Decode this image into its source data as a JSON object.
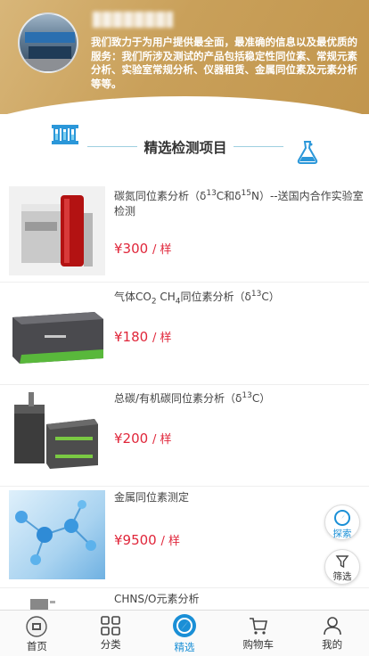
{
  "header": {
    "intro": "我们致力于为用户提供最全面，最准确的信息以及最优质的服务：我们所涉及测试的产品包括稳定性同位素、常规元素分析、实验室常规分析、仪器租赁、金属同位素及元素分析等等。"
  },
  "section": {
    "title": "精选检测项目"
  },
  "items": [
    {
      "title_pre": "碳氮同位素分析（δ",
      "sup1": "13",
      "title_mid": "C和δ",
      "sup2": "15",
      "title_post": "N）--送国内合作实验室检测",
      "price": "¥300",
      "unit": "/ 样"
    },
    {
      "title_pre": "气体CO",
      "sub1": "2",
      "title_mid": " CH",
      "sub2": "4",
      "title_mid2": "同位素分析（δ",
      "sup1": "13",
      "title_post": "C）",
      "price": "¥180",
      "unit": "/ 样"
    },
    {
      "title_pre": "总碳/有机碳同位素分析（δ",
      "sup1": "13",
      "title_post": "C）",
      "price": "¥200",
      "unit": "/ 样"
    },
    {
      "title": "金属同位素测定",
      "price": "¥9500",
      "unit": "/ 样"
    },
    {
      "title": "CHNS/O元素分析"
    }
  ],
  "float_buttons": {
    "explore": "探索",
    "filter": "筛选"
  },
  "tabbar": [
    {
      "label": "首页",
      "icon": "home-icon"
    },
    {
      "label": "分类",
      "icon": "grid-icon"
    },
    {
      "label": "精选",
      "icon": "compass-icon",
      "active": true
    },
    {
      "label": "购物车",
      "icon": "cart-icon"
    },
    {
      "label": "我的",
      "icon": "user-icon"
    }
  ],
  "colors": {
    "accent": "#1a8fd6",
    "price": "#e0263a",
    "header": "#c9a05a"
  }
}
